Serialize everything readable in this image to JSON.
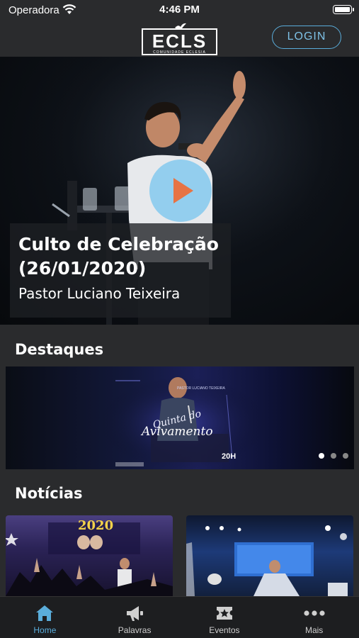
{
  "status_bar": {
    "carrier": "Operadora",
    "time": "4:46 PM"
  },
  "header": {
    "logo_text": "ECLS",
    "logo_subtitle": "COMUNIDADE ECLESIA",
    "login_label": "LOGIN"
  },
  "hero": {
    "title": "Culto de Celebração (26/01/2020)",
    "subtitle": "Pastor Luciano Teixeira"
  },
  "highlights": {
    "section_title": "Destaques",
    "banner": {
      "pastor_name": "PASTOR LUCIANO TEIXEIRA",
      "script_line1": "Quinta do",
      "script_line2": "Avivamento",
      "time": "20H"
    },
    "page_count": 3,
    "active_page": 1
  },
  "news": {
    "section_title": "Notícias",
    "card1_overlay": "2020"
  },
  "tabs": [
    {
      "label": "Home",
      "icon": "home-icon",
      "active": true
    },
    {
      "label": "Palavras",
      "icon": "megaphone-icon",
      "active": false
    },
    {
      "label": "Eventos",
      "icon": "ticket-icon",
      "active": false
    },
    {
      "label": "Mais",
      "icon": "more-icon",
      "active": false
    }
  ],
  "colors": {
    "background": "#2a2b2d",
    "accent": "#5aaddb",
    "play_button": "#8fcdef",
    "play_triangle": "#e86d3a"
  }
}
